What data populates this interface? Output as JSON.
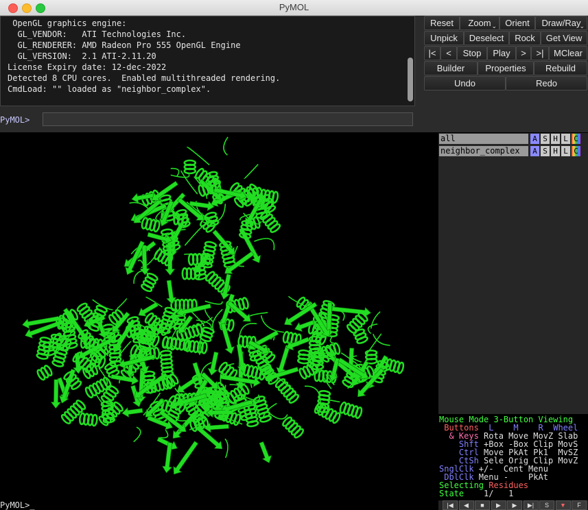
{
  "window": {
    "title": "PyMOL"
  },
  "console": {
    "lines": [
      " OpenGL graphics engine:",
      "  GL_VENDOR:   ATI Technologies Inc.",
      "  GL_RENDERER: AMD Radeon Pro 555 OpenGL Engine",
      "  GL_VERSION:  2.1 ATI-2.11.20",
      "License Expiry date: 12-dec-2022",
      "Detected 8 CPU cores.  Enabled multithreaded rendering.",
      "CmdLoad: \"\" loaded as \"neighbor_complex\"."
    ]
  },
  "command": {
    "prompt": "PyMOL>",
    "value": "",
    "bottom_prompt": "PyMOL>_"
  },
  "buttons": {
    "reset": "Reset",
    "zoom": "Zoom",
    "orient": "Orient",
    "draw_ray": "Draw/Ray",
    "unpick": "Unpick",
    "deselect": "Deselect",
    "rock": "Rock",
    "get_view": "Get View",
    "first": "|<",
    "prev": "<",
    "stop": "Stop",
    "play": "Play",
    "next": ">",
    "last": ">|",
    "mclear": "MClear",
    "builder": "Builder",
    "properties": "Properties",
    "rebuild": "Rebuild",
    "undo": "Undo",
    "redo": "Redo"
  },
  "objects": [
    {
      "name": "all",
      "a": "A",
      "s": "S",
      "h": "H",
      "l": "L",
      "c": "C"
    },
    {
      "name": "neighbor_complex",
      "a": "A",
      "s": "S",
      "h": "H",
      "l": "L",
      "c": "C"
    }
  ],
  "mouse_mode": {
    "header_left": "Mouse Mode",
    "header_right": "3-Button Viewing",
    "buttons_label": "Buttons",
    "col_l": "L",
    "col_m": "M",
    "col_r": "R",
    "col_wheel": "Wheel",
    "rows": [
      {
        "mod": "& Keys",
        "l": "Rota",
        "m": "Move",
        "r": "MovZ",
        "w": "Slab"
      },
      {
        "mod": "Shft",
        "l": "+Box",
        "m": "-Box",
        "r": "Clip",
        "w": "MovS"
      },
      {
        "mod": "Ctrl",
        "l": "Move",
        "m": "PkAt",
        "r": "Pk1",
        "w": "MvSZ"
      },
      {
        "mod": "CtSh",
        "l": "Sele",
        "m": "Orig",
        "r": "Clip",
        "w": "MovZ"
      },
      {
        "mod": "SnglClk",
        "l": "+/-",
        "m": "Cent",
        "r": "Menu",
        "w": ""
      },
      {
        "mod": "DblClk",
        "l": "Menu",
        "m": "-",
        "r": "PkAt",
        "w": ""
      }
    ],
    "selecting_label": "Selecting",
    "selecting_value": "Residues",
    "state_label": "State",
    "state_value": "1/   1"
  },
  "transport": {
    "icons": [
      "rewind-icon",
      "back-icon",
      "stop-icon",
      "play-icon",
      "forward-icon",
      "end-icon",
      "scene-icon",
      "down-icon",
      "fullscreen-icon"
    ],
    "glyphs": [
      "|◀",
      "◀",
      "■",
      "▶",
      "▶",
      "▶|",
      "S",
      "▼",
      "F"
    ]
  },
  "colors": {
    "protein": "#22dd22",
    "background": "#000000"
  }
}
